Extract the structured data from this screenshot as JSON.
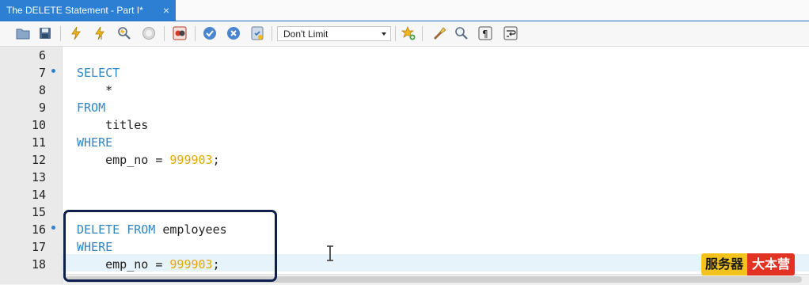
{
  "tab": {
    "title": "The DELETE Statement - Part I*",
    "close": "×"
  },
  "toolbar": {
    "icons": [
      "open-folder",
      "save",
      "execute",
      "execute-current",
      "explain",
      "stop",
      "toggle-error",
      "commit",
      "rollback",
      "autocommit"
    ],
    "limit_value": "Don't Limit",
    "right_icons": [
      "add-snippet",
      "beautify",
      "find",
      "invisibles",
      "word-wrap"
    ]
  },
  "editor": {
    "line_numbers": [
      "6",
      "7",
      "8",
      "9",
      "10",
      "11",
      "12",
      "13",
      "14",
      "15",
      "16",
      "17",
      "18"
    ],
    "marked_lines": [
      "7",
      "16"
    ],
    "lines": [
      {
        "line": "6",
        "keyword": "",
        "text": "",
        "number": "",
        "end": ""
      },
      {
        "line": "7",
        "keyword": "SELECT",
        "text": "",
        "number": "",
        "end": ""
      },
      {
        "line": "8",
        "keyword": "",
        "text": "    *",
        "number": "",
        "end": ""
      },
      {
        "line": "9",
        "keyword": "FROM",
        "text": "",
        "number": "",
        "end": ""
      },
      {
        "line": "10",
        "keyword": "",
        "text": "    titles",
        "number": "",
        "end": ""
      },
      {
        "line": "11",
        "keyword": "WHERE",
        "text": "",
        "number": "",
        "end": ""
      },
      {
        "line": "12",
        "keyword": "",
        "text": "    emp_no = ",
        "number": "999903",
        "end": ";"
      },
      {
        "line": "13",
        "keyword": "",
        "text": "",
        "number": "",
        "end": ""
      },
      {
        "line": "14",
        "keyword": "",
        "text": "",
        "number": "",
        "end": ""
      },
      {
        "line": "15",
        "keyword": "",
        "text": "",
        "number": "",
        "end": ""
      },
      {
        "line": "16",
        "keyword": "DELETE FROM",
        "text": " employees",
        "number": "",
        "end": ""
      },
      {
        "line": "17",
        "keyword": "WHERE",
        "text": "",
        "number": "",
        "end": ""
      },
      {
        "line": "18",
        "keyword": "",
        "text": "    emp_no = ",
        "number": "999903",
        "end": ";"
      }
    ],
    "colors": {
      "keyword": "#2f86c3",
      "number": "#e2a800",
      "annotation_box": "#0c1f4d"
    }
  },
  "watermark": {
    "part1": "服务器",
    "part2": "大本营"
  }
}
